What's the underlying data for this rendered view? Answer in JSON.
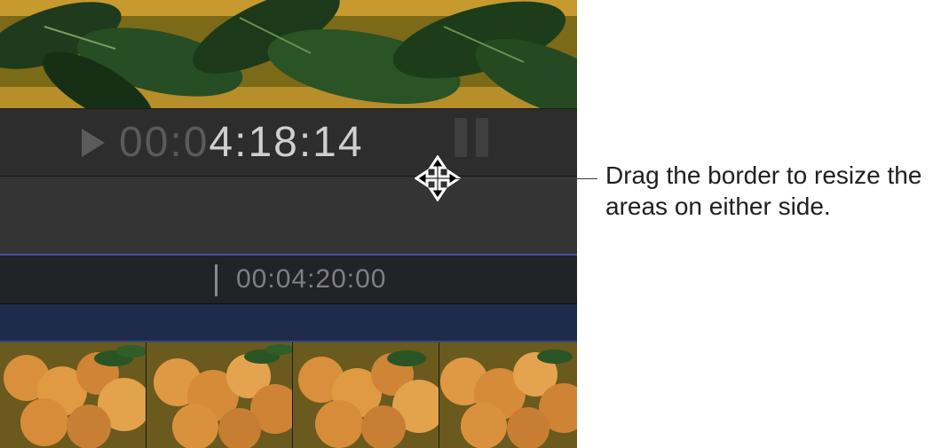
{
  "timecode": {
    "dim_prefix": "00:0",
    "bright_value": "4:18:14"
  },
  "ruler": {
    "timecode": "00:04:20:00"
  },
  "callout": {
    "text": "Drag the border to resize the areas on either side."
  }
}
